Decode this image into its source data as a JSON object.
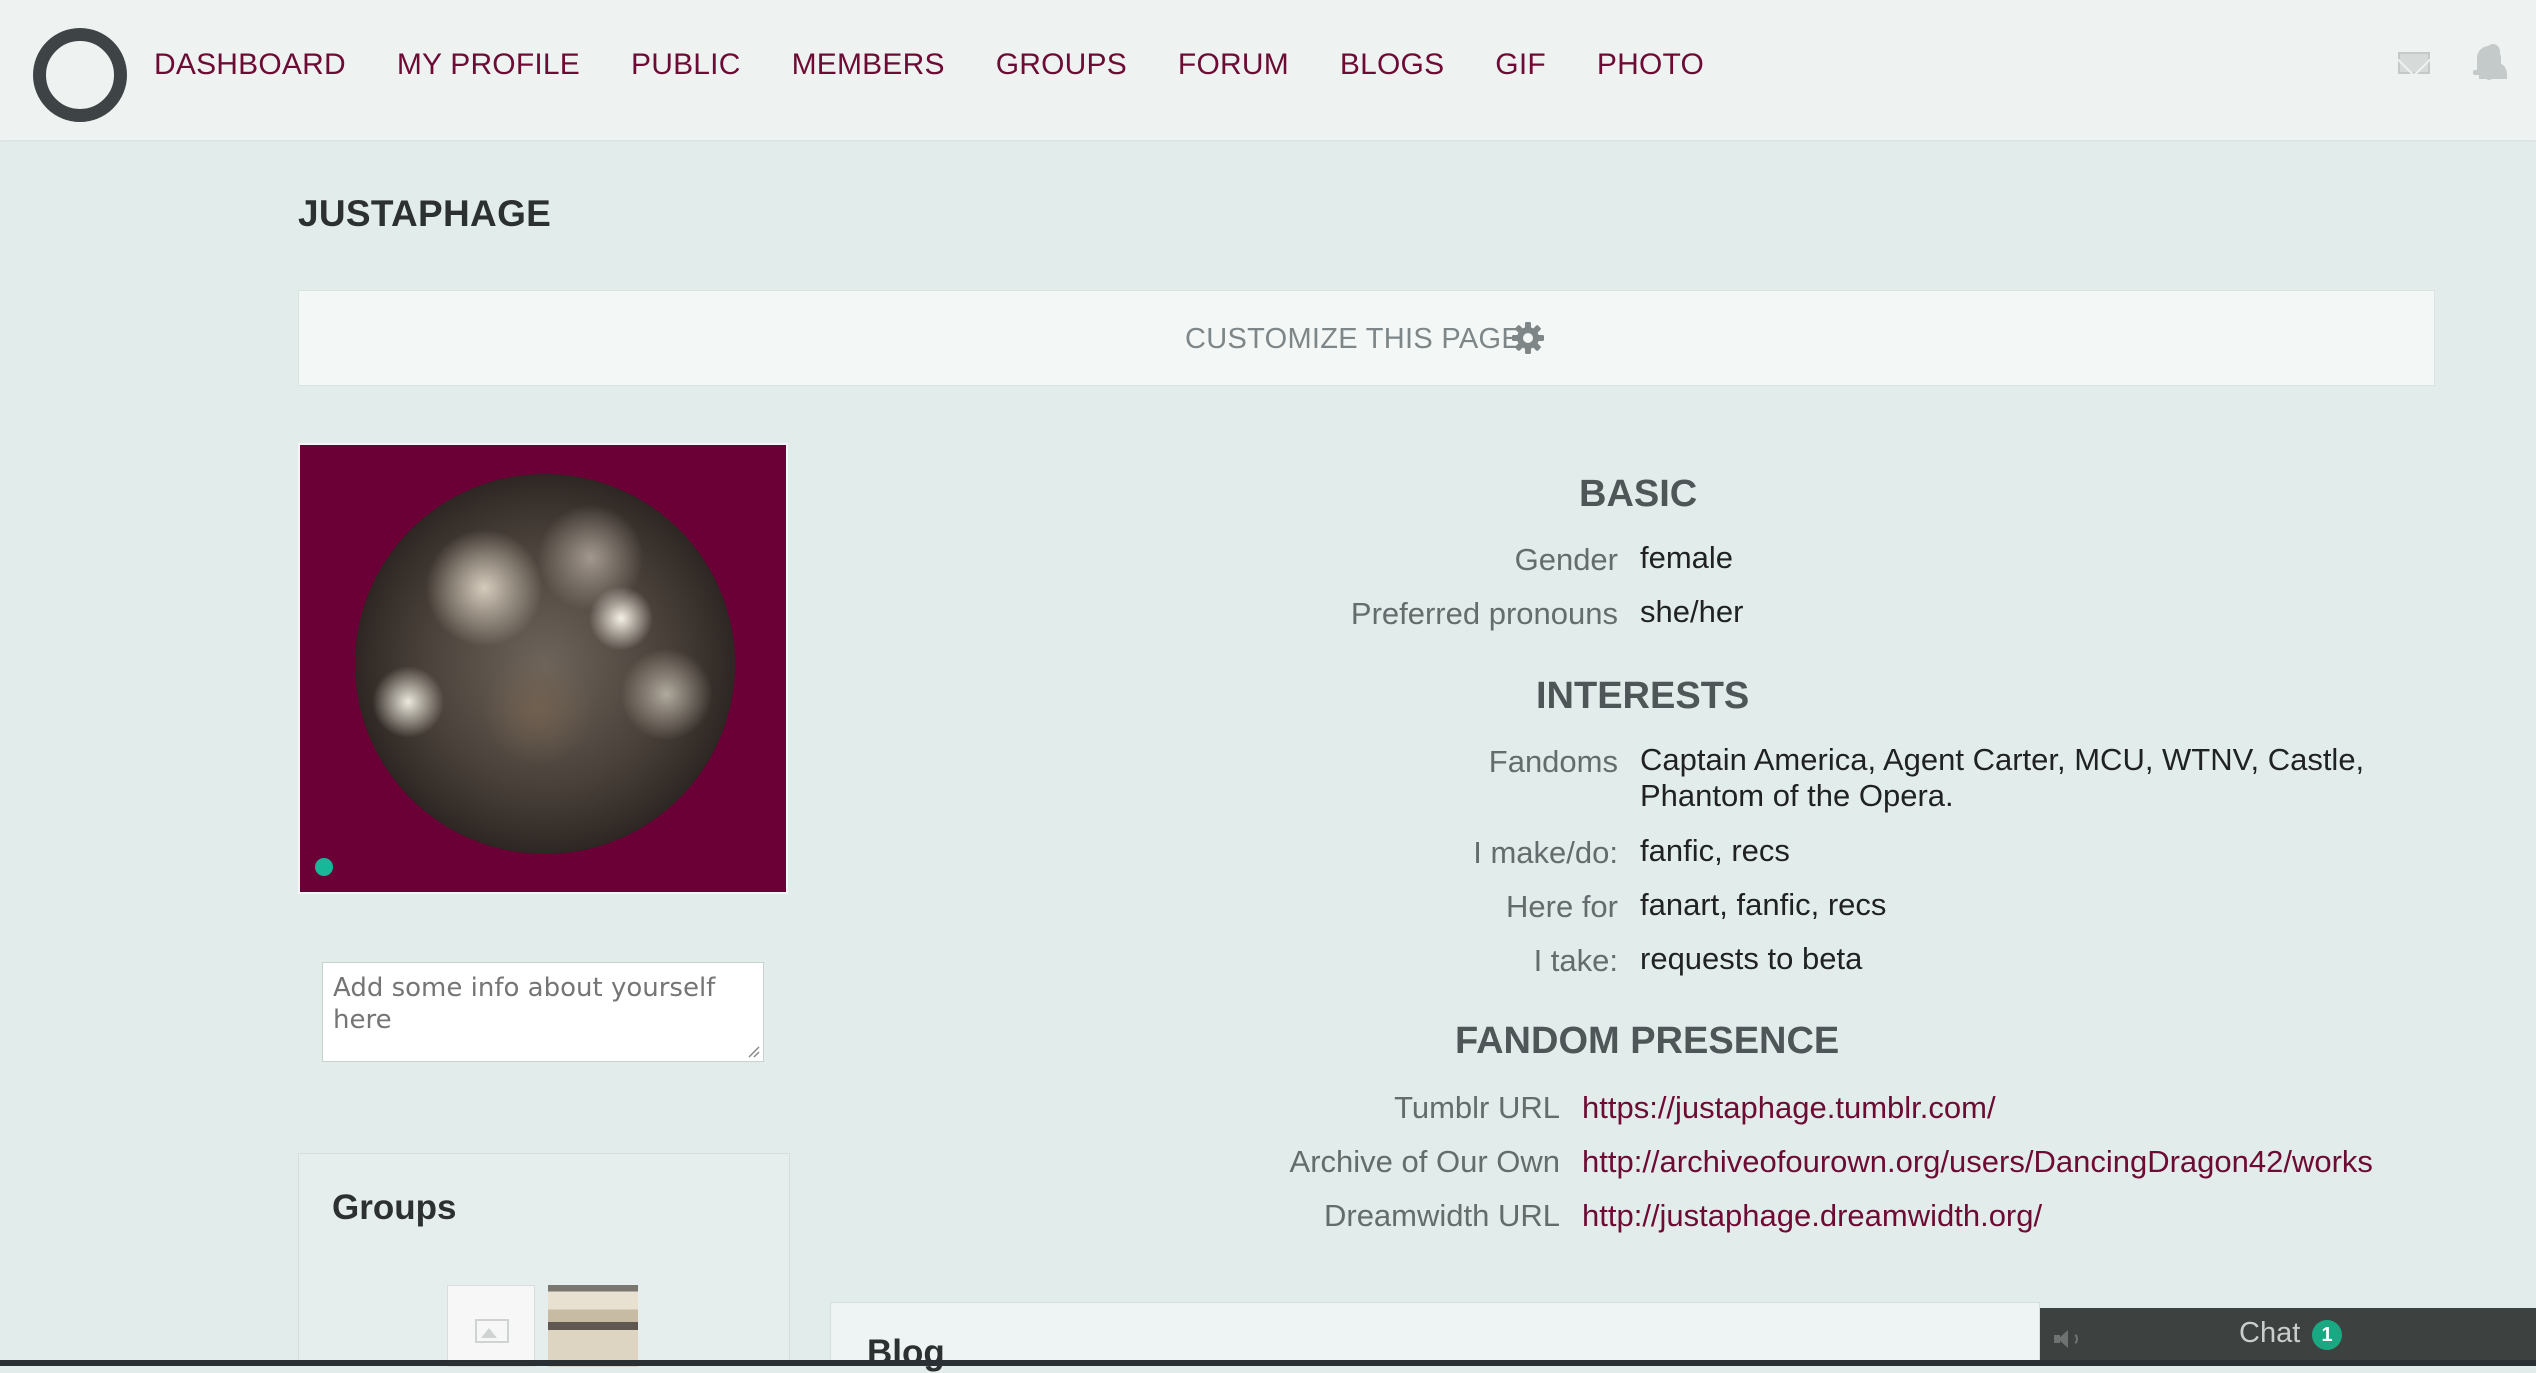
{
  "nav": {
    "items": [
      {
        "label": "DASHBOARD"
      },
      {
        "label": "MY PROFILE"
      },
      {
        "label": "PUBLIC"
      },
      {
        "label": "MEMBERS"
      },
      {
        "label": "GROUPS"
      },
      {
        "label": "FORUM"
      },
      {
        "label": "BLOGS"
      },
      {
        "label": "GIF"
      },
      {
        "label": "PHOTO"
      }
    ],
    "icons": [
      "mail-icon",
      "bell-icon",
      "user-icon"
    ],
    "link_color": "#6d0b35"
  },
  "profile": {
    "username": "JUSTAPHAGE",
    "customize_label": "CUSTOMIZE THIS PAGE",
    "about_placeholder": "Add some info about yourself here",
    "avatar_bg_color": "#6a0035",
    "online_color": "#17b89a"
  },
  "basic": {
    "heading": "BASIC",
    "rows": [
      {
        "label": "Gender",
        "value": "female"
      },
      {
        "label": "Preferred pronouns",
        "value": "she/her"
      }
    ]
  },
  "interests": {
    "heading": "INTERESTS",
    "rows": [
      {
        "label": "Fandoms",
        "value": "Captain America, Agent Carter, MCU, WTNV, Castle,",
        "value_line2": "Phantom of the Opera."
      },
      {
        "label": "I make/do:",
        "value": "fanfic, recs"
      },
      {
        "label": "Here for",
        "value": "fanart, fanfic, recs"
      },
      {
        "label": "I take:",
        "value": "requests to beta"
      }
    ]
  },
  "fandom_presence": {
    "heading": "FANDOM PRESENCE",
    "rows": [
      {
        "label": "Tumblr URL",
        "value": "https://justaphage.tumblr.com/"
      },
      {
        "label": "Archive of Our Own",
        "value": "http://archiveofourown.org/users/DancingDragon42/works"
      },
      {
        "label": "Dreamwidth URL",
        "value": "http://justaphage.dreamwidth.org/"
      }
    ]
  },
  "groups": {
    "title": "Groups"
  },
  "blog": {
    "title": "Blog"
  },
  "chat": {
    "label": "Chat",
    "badge": "1"
  }
}
